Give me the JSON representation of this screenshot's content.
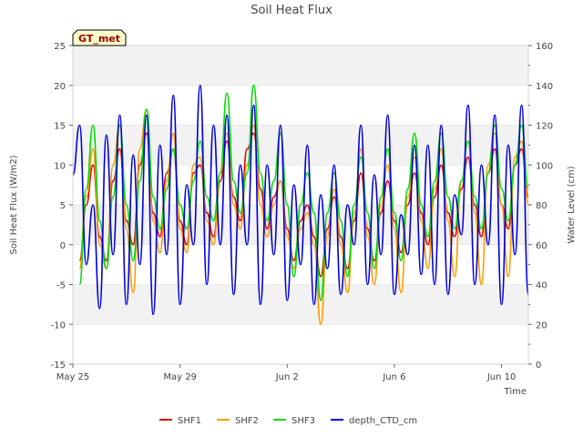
{
  "chart_data": {
    "type": "line",
    "title": "Soil Heat Flux",
    "xlabel": "Time",
    "ylabel": "Soil Heat Flux (W/m2)",
    "y2label": "Water Level (cm)",
    "site_badge": "GT_met",
    "x_range": [
      "2025-05-25",
      "2025-06-11"
    ],
    "x_ticks": [
      {
        "x": "2025-05-25",
        "label": "May 25"
      },
      {
        "x": "2025-05-29",
        "label": "May 29"
      },
      {
        "x": "2025-06-02",
        "label": "Jun 2"
      },
      {
        "x": "2025-06-06",
        "label": "Jun 6"
      },
      {
        "x": "2025-06-10",
        "label": "Jun 10"
      }
    ],
    "ylim": [
      -15,
      25
    ],
    "y_ticks": [
      -15,
      -10,
      -5,
      0,
      5,
      10,
      15,
      20,
      25
    ],
    "y2lim": [
      0,
      160
    ],
    "y2_ticks": [
      0,
      20,
      40,
      60,
      80,
      100,
      120,
      140,
      160
    ],
    "grid": "horizontal bands",
    "legend_position": "bottom",
    "series": [
      {
        "name": "SHF1",
        "color": "#dd0000",
        "axis": "left",
        "x": [
          "2025-05-25T06:00",
          "2025-05-25T12:00",
          "2025-05-25T18:00",
          "2025-05-26T00:00",
          "2025-05-26T06:00",
          "2025-05-26T12:00",
          "2025-05-26T18:00",
          "2025-05-27T00:00",
          "2025-05-27T06:00",
          "2025-05-27T12:00",
          "2025-05-27T18:00",
          "2025-05-28T00:00",
          "2025-05-28T06:00",
          "2025-05-28T12:00",
          "2025-05-28T18:00",
          "2025-05-29T00:00",
          "2025-05-29T06:00",
          "2025-05-29T12:00",
          "2025-05-29T18:00",
          "2025-05-30T00:00",
          "2025-05-30T06:00",
          "2025-05-30T12:00",
          "2025-05-30T18:00",
          "2025-05-31T00:00",
          "2025-05-31T06:00",
          "2025-05-31T12:00",
          "2025-05-31T18:00",
          "2025-06-01T00:00",
          "2025-06-01T06:00",
          "2025-06-01T12:00",
          "2025-06-01T18:00",
          "2025-06-02T00:00",
          "2025-06-02T06:00",
          "2025-06-02T12:00",
          "2025-06-02T18:00",
          "2025-06-03T00:00",
          "2025-06-03T06:00",
          "2025-06-03T12:00",
          "2025-06-03T18:00",
          "2025-06-04T00:00",
          "2025-06-04T06:00",
          "2025-06-04T12:00",
          "2025-06-04T18:00",
          "2025-06-05T00:00",
          "2025-06-05T06:00",
          "2025-06-05T12:00",
          "2025-06-05T18:00",
          "2025-06-06T00:00",
          "2025-06-06T06:00",
          "2025-06-06T12:00",
          "2025-06-06T18:00",
          "2025-06-07T00:00",
          "2025-06-07T06:00",
          "2025-06-07T12:00",
          "2025-06-07T18:00",
          "2025-06-08T00:00",
          "2025-06-08T06:00",
          "2025-06-08T12:00",
          "2025-06-08T18:00",
          "2025-06-09T00:00",
          "2025-06-09T06:00",
          "2025-06-09T12:00",
          "2025-06-09T18:00",
          "2025-06-10T00:00",
          "2025-06-10T06:00",
          "2025-06-10T12:00",
          "2025-06-10T18:00",
          "2025-06-11T00:00"
        ],
        "values": [
          -2,
          5,
          10,
          1,
          -2,
          8,
          12,
          3,
          0,
          10,
          14,
          4,
          1,
          9,
          12,
          3,
          0,
          9,
          10,
          4,
          1,
          8,
          13,
          6,
          3,
          12,
          14,
          7,
          2,
          6,
          8,
          2,
          -2,
          3,
          5,
          1,
          -4,
          2,
          6,
          1,
          -3,
          3,
          9,
          2,
          -2,
          4,
          8,
          3,
          -1,
          5,
          9,
          4,
          0,
          6,
          10,
          4,
          1,
          7,
          11,
          5,
          1,
          9,
          12,
          5,
          2,
          10,
          12,
          6
        ]
      },
      {
        "name": "SHF2",
        "color": "#ff9900",
        "axis": "left",
        "x": [
          "2025-05-25T06:00",
          "2025-05-25T12:00",
          "2025-05-25T18:00",
          "2025-05-26T00:00",
          "2025-05-26T06:00",
          "2025-05-26T12:00",
          "2025-05-26T18:00",
          "2025-05-27T00:00",
          "2025-05-27T06:00",
          "2025-05-27T12:00",
          "2025-05-27T18:00",
          "2025-05-28T00:00",
          "2025-05-28T06:00",
          "2025-05-28T12:00",
          "2025-05-28T18:00",
          "2025-05-29T00:00",
          "2025-05-29T06:00",
          "2025-05-29T12:00",
          "2025-05-29T18:00",
          "2025-05-30T00:00",
          "2025-05-30T06:00",
          "2025-05-30T12:00",
          "2025-05-30T18:00",
          "2025-05-31T00:00",
          "2025-05-31T06:00",
          "2025-05-31T12:00",
          "2025-05-31T18:00",
          "2025-06-01T00:00",
          "2025-06-01T06:00",
          "2025-06-01T12:00",
          "2025-06-01T18:00",
          "2025-06-02T00:00",
          "2025-06-02T06:00",
          "2025-06-02T12:00",
          "2025-06-02T18:00",
          "2025-06-03T00:00",
          "2025-06-03T06:00",
          "2025-06-03T12:00",
          "2025-06-03T18:00",
          "2025-06-04T00:00",
          "2025-06-04T06:00",
          "2025-06-04T12:00",
          "2025-06-04T18:00",
          "2025-06-05T00:00",
          "2025-06-05T06:00",
          "2025-06-05T12:00",
          "2025-06-05T18:00",
          "2025-06-06T00:00",
          "2025-06-06T06:00",
          "2025-06-06T12:00",
          "2025-06-06T18:00",
          "2025-06-07T00:00",
          "2025-06-07T06:00",
          "2025-06-07T12:00",
          "2025-06-07T18:00",
          "2025-06-08T00:00",
          "2025-06-08T06:00",
          "2025-06-08T12:00",
          "2025-06-08T18:00",
          "2025-06-09T00:00",
          "2025-06-09T06:00",
          "2025-06-09T12:00",
          "2025-06-09T18:00",
          "2025-06-10T00:00",
          "2025-06-10T06:00",
          "2025-06-10T12:00",
          "2025-06-10T18:00",
          "2025-06-11T00:00"
        ],
        "values": [
          -3,
          6,
          12,
          0,
          -3,
          10,
          15,
          2,
          -6,
          12,
          17,
          3,
          -1,
          8,
          14,
          2,
          -1,
          10,
          11,
          3,
          0,
          9,
          14,
          5,
          2,
          10,
          15,
          5,
          1,
          5,
          8,
          1,
          -3,
          2,
          4,
          0,
          -10,
          1,
          7,
          0,
          -6,
          4,
          12,
          1,
          -5,
          5,
          10,
          2,
          -6,
          6,
          11,
          3,
          -3,
          7,
          12,
          3,
          -4,
          8,
          13,
          4,
          -5,
          10,
          14,
          5,
          -4,
          11,
          13,
          5
        ]
      },
      {
        "name": "SHF3",
        "color": "#00dd00",
        "axis": "left",
        "x": [
          "2025-05-25T06:00",
          "2025-05-25T12:00",
          "2025-05-25T18:00",
          "2025-05-26T00:00",
          "2025-05-26T06:00",
          "2025-05-26T12:00",
          "2025-05-26T18:00",
          "2025-05-27T00:00",
          "2025-05-27T06:00",
          "2025-05-27T12:00",
          "2025-05-27T18:00",
          "2025-05-28T00:00",
          "2025-05-28T06:00",
          "2025-05-28T12:00",
          "2025-05-28T18:00",
          "2025-05-29T00:00",
          "2025-05-29T06:00",
          "2025-05-29T12:00",
          "2025-05-29T18:00",
          "2025-05-30T00:00",
          "2025-05-30T06:00",
          "2025-05-30T12:00",
          "2025-05-30T18:00",
          "2025-05-31T00:00",
          "2025-05-31T06:00",
          "2025-05-31T12:00",
          "2025-05-31T18:00",
          "2025-06-01T00:00",
          "2025-06-01T06:00",
          "2025-06-01T12:00",
          "2025-06-01T18:00",
          "2025-06-02T00:00",
          "2025-06-02T06:00",
          "2025-06-02T12:00",
          "2025-06-02T18:00",
          "2025-06-03T00:00",
          "2025-06-03T06:00",
          "2025-06-03T12:00",
          "2025-06-03T18:00",
          "2025-06-04T00:00",
          "2025-06-04T06:00",
          "2025-06-04T12:00",
          "2025-06-04T18:00",
          "2025-06-05T00:00",
          "2025-06-05T06:00",
          "2025-06-05T12:00",
          "2025-06-05T18:00",
          "2025-06-06T00:00",
          "2025-06-06T06:00",
          "2025-06-06T12:00",
          "2025-06-06T18:00",
          "2025-06-07T00:00",
          "2025-06-07T06:00",
          "2025-06-07T12:00",
          "2025-06-07T18:00",
          "2025-06-08T00:00",
          "2025-06-08T06:00",
          "2025-06-08T12:00",
          "2025-06-08T18:00",
          "2025-06-09T00:00",
          "2025-06-09T06:00",
          "2025-06-09T12:00",
          "2025-06-09T18:00",
          "2025-06-10T00:00",
          "2025-06-10T06:00",
          "2025-06-10T12:00",
          "2025-06-10T18:00",
          "2025-06-11T00:00"
        ],
        "values": [
          -5,
          7,
          15,
          3,
          -3,
          6,
          15,
          5,
          -2,
          8,
          17,
          6,
          2,
          7,
          12,
          5,
          2,
          8,
          13,
          6,
          3,
          9,
          19,
          8,
          4,
          9,
          20,
          9,
          3,
          8,
          14,
          5,
          -4,
          5,
          9,
          4,
          -7,
          4,
          9,
          3,
          -4,
          5,
          11,
          4,
          -3,
          6,
          12,
          4,
          -2,
          7,
          14,
          5,
          1,
          8,
          14,
          6,
          2,
          8,
          13,
          6,
          2,
          9,
          15,
          7,
          3,
          10,
          15,
          7
        ]
      },
      {
        "name": "depth_CTD_cm",
        "color": "#0000dd",
        "axis": "right",
        "x": [
          "2025-05-25T00:00",
          "2025-05-25T06:00",
          "2025-05-25T12:00",
          "2025-05-25T18:00",
          "2025-05-26T00:00",
          "2025-05-26T06:00",
          "2025-05-26T12:00",
          "2025-05-26T18:00",
          "2025-05-27T00:00",
          "2025-05-27T06:00",
          "2025-05-27T12:00",
          "2025-05-27T18:00",
          "2025-05-28T00:00",
          "2025-05-28T06:00",
          "2025-05-28T12:00",
          "2025-05-28T18:00",
          "2025-05-29T00:00",
          "2025-05-29T06:00",
          "2025-05-29T12:00",
          "2025-05-29T18:00",
          "2025-05-30T00:00",
          "2025-05-30T06:00",
          "2025-05-30T12:00",
          "2025-05-30T18:00",
          "2025-05-31T00:00",
          "2025-05-31T06:00",
          "2025-05-31T12:00",
          "2025-05-31T18:00",
          "2025-06-01T00:00",
          "2025-06-01T06:00",
          "2025-06-01T12:00",
          "2025-06-01T18:00",
          "2025-06-02T00:00",
          "2025-06-02T06:00",
          "2025-06-02T12:00",
          "2025-06-02T18:00",
          "2025-06-03T00:00",
          "2025-06-03T06:00",
          "2025-06-03T12:00",
          "2025-06-03T18:00",
          "2025-06-04T00:00",
          "2025-06-04T06:00",
          "2025-06-04T12:00",
          "2025-06-04T18:00",
          "2025-06-05T00:00",
          "2025-06-05T06:00",
          "2025-06-05T12:00",
          "2025-06-05T18:00",
          "2025-06-06T00:00",
          "2025-06-06T06:00",
          "2025-06-06T12:00",
          "2025-06-06T18:00",
          "2025-06-07T00:00",
          "2025-06-07T06:00",
          "2025-06-07T12:00",
          "2025-06-07T18:00",
          "2025-06-08T00:00",
          "2025-06-08T06:00",
          "2025-06-08T12:00",
          "2025-06-08T18:00",
          "2025-06-09T00:00",
          "2025-06-09T06:00",
          "2025-06-09T12:00",
          "2025-06-09T18:00",
          "2025-06-10T00:00",
          "2025-06-10T06:00",
          "2025-06-10T12:00",
          "2025-06-10T18:00",
          "2025-06-11T00:00"
        ],
        "values": [
          95,
          120,
          50,
          80,
          28,
          115,
          55,
          125,
          30,
          105,
          50,
          125,
          25,
          110,
          55,
          135,
          30,
          90,
          60,
          140,
          40,
          120,
          60,
          125,
          35,
          100,
          60,
          130,
          30,
          100,
          55,
          120,
          32,
          90,
          50,
          110,
          30,
          85,
          48,
          100,
          35,
          80,
          60,
          120,
          40,
          95,
          55,
          125,
          35,
          75,
          55,
          110,
          45,
          110,
          40,
          120,
          35,
          85,
          65,
          130,
          40,
          100,
          60,
          125,
          30,
          110,
          55,
          130,
          35
        ]
      }
    ]
  }
}
